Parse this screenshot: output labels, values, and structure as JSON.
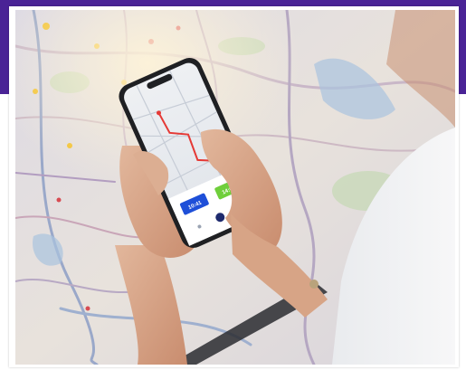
{
  "photo": {
    "subject": "hand-holding-phone-map-app",
    "colors": {
      "banner": "#4a2396",
      "route": "#e53935",
      "chip_blue": "#1e4fd8",
      "chip_green": "#6fcf3b"
    }
  },
  "phone": {
    "chip_left": "10:41",
    "chip_right": "14:00"
  }
}
